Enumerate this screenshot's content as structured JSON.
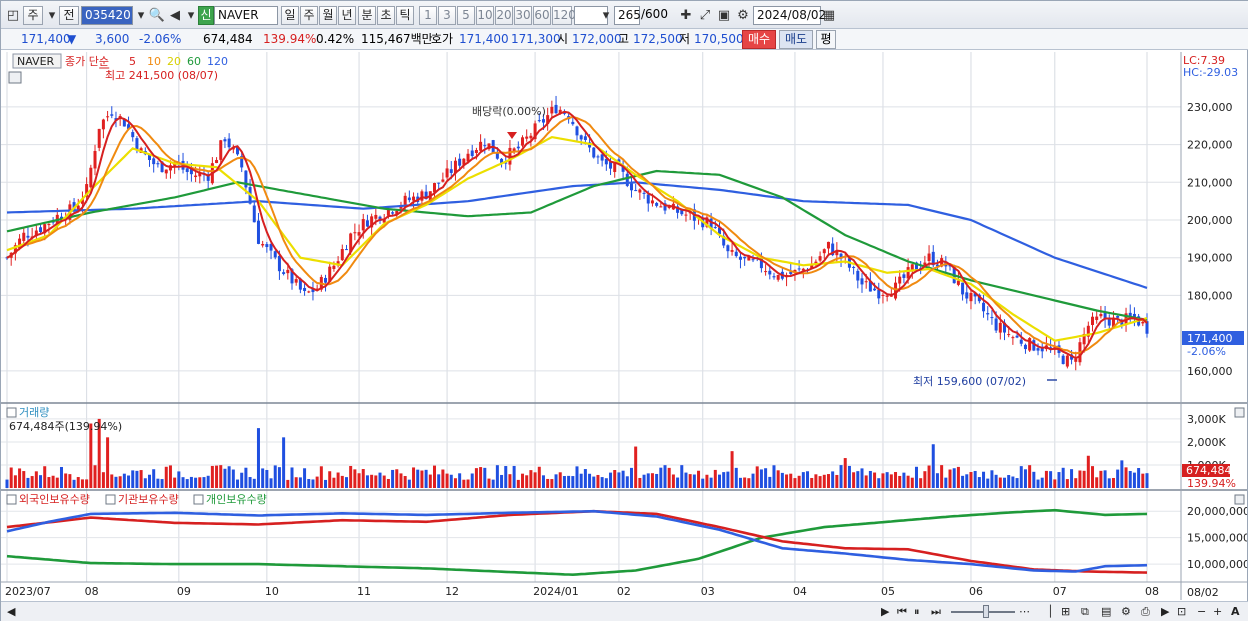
{
  "toolbar": {
    "period_labels": [
      "주",
      "전"
    ],
    "stock_code": "035420",
    "stock_name": "NAVER",
    "credit_badge": "신",
    "intervals": [
      "일",
      "주",
      "월",
      "년",
      "분",
      "초",
      "틱"
    ],
    "active_interval": "일",
    "numbers": [
      "1",
      "3",
      "5",
      "10",
      "20",
      "30",
      "60",
      "120"
    ],
    "count": "265",
    "count_total": "/600",
    "date": "2024/08/02"
  },
  "quote": {
    "price": "171,400",
    "change": "3,600",
    "change_pct": "-2.06%",
    "volume": "674,484",
    "volume_ratio": "139.94%",
    "turnover": "0.42%",
    "amount": "115,467백만",
    "ask_label": "호가",
    "ask1": "171,400",
    "ask2": "171,300",
    "open_label": "시",
    "open": "172,000",
    "high_label": "고",
    "high": "172,500",
    "low_label": "저",
    "low": "170,500",
    "buy_label": "매수",
    "sell_label": "매도",
    "eval_label": "평"
  },
  "chart_data": {
    "type": "line",
    "symbol": "NAVER",
    "legend": [
      {
        "name": "종가 단순",
        "color": "#d62020"
      },
      {
        "name": "5",
        "color": "#d62020"
      },
      {
        "name": "10",
        "color": "#f08a10"
      },
      {
        "name": "20",
        "color": "#e8e000"
      },
      {
        "name": "60",
        "color": "#1f9a3a"
      },
      {
        "name": "120",
        "color": "#2f5fe0"
      }
    ],
    "x_labels": [
      "2023/07",
      "08",
      "09",
      "10",
      "11",
      "12",
      "2024/01",
      "02",
      "03",
      "04",
      "05",
      "06",
      "07",
      "08"
    ],
    "current_date": "08/02",
    "price_axis": {
      "ylim": [
        152000,
        243500
      ],
      "ticks": [
        "230,000",
        "220,000",
        "210,000",
        "200,000",
        "190,000",
        "180,000",
        "160,000"
      ],
      "tick_values": [
        230000,
        220000,
        210000,
        200000,
        190000,
        180000,
        160000
      ]
    },
    "lc_label": "LC:7.39",
    "hc_label": "HC:-29.03",
    "last_price": "171,400",
    "last_change": "-2.06%",
    "high_annotation": "최고 241,500 (08/07)",
    "low_annotation": "최저 159,600 (07/02)",
    "dividend_annotation": "배당락(0.00%)",
    "price_anchors": [
      [
        0,
        190000
      ],
      [
        4,
        196000
      ],
      [
        8,
        198000
      ],
      [
        12,
        201000
      ],
      [
        16,
        203000
      ],
      [
        19,
        208000
      ],
      [
        22,
        225000
      ],
      [
        25,
        229000
      ],
      [
        28,
        226000
      ],
      [
        32,
        218000
      ],
      [
        36,
        214000
      ],
      [
        40,
        215000
      ],
      [
        44,
        212000
      ],
      [
        48,
        212000
      ],
      [
        52,
        222000
      ],
      [
        56,
        214000
      ],
      [
        60,
        195000
      ],
      [
        64,
        189000
      ],
      [
        68,
        184000
      ],
      [
        71,
        180000
      ],
      [
        74,
        182000
      ],
      [
        78,
        188000
      ],
      [
        82,
        196000
      ],
      [
        86,
        200000
      ],
      [
        90,
        202000
      ],
      [
        95,
        205000
      ],
      [
        100,
        207000
      ],
      [
        105,
        212000
      ],
      [
        110,
        218000
      ],
      [
        114,
        221000
      ],
      [
        118,
        216000
      ],
      [
        122,
        219000
      ],
      [
        126,
        224000
      ],
      [
        131,
        230000
      ],
      [
        134,
        228000
      ],
      [
        138,
        220000
      ],
      [
        142,
        215000
      ],
      [
        146,
        213000
      ],
      [
        150,
        208000
      ],
      [
        154,
        205000
      ],
      [
        158,
        203000
      ],
      [
        163,
        201000
      ],
      [
        168,
        199000
      ],
      [
        172,
        191000
      ],
      [
        176,
        189000
      ],
      [
        180,
        188000
      ],
      [
        184,
        185000
      ],
      [
        188,
        186000
      ],
      [
        192,
        188000
      ],
      [
        196,
        193000
      ],
      [
        200,
        189000
      ],
      [
        204,
        183000
      ],
      [
        208,
        181000
      ],
      [
        212,
        182000
      ],
      [
        216,
        187000
      ],
      [
        220,
        190000
      ],
      [
        224,
        188000
      ],
      [
        228,
        181000
      ],
      [
        232,
        177000
      ],
      [
        236,
        172000
      ],
      [
        240,
        169000
      ],
      [
        244,
        167000
      ],
      [
        248,
        166000
      ],
      [
        251,
        164000
      ],
      [
        254,
        162000
      ],
      [
        258,
        172000
      ],
      [
        261,
        174000
      ],
      [
        265,
        173000
      ],
      [
        269,
        174000
      ],
      [
        272,
        171400
      ]
    ],
    "ma_anchors": {
      "ma20": [
        [
          0,
          192000
        ],
        [
          10,
          196000
        ],
        [
          20,
          208000
        ],
        [
          30,
          219000
        ],
        [
          40,
          215000
        ],
        [
          50,
          214000
        ],
        [
          60,
          205000
        ],
        [
          70,
          190000
        ],
        [
          80,
          188000
        ],
        [
          90,
          199000
        ],
        [
          100,
          204000
        ],
        [
          110,
          211000
        ],
        [
          120,
          216000
        ],
        [
          130,
          222000
        ],
        [
          140,
          220000
        ],
        [
          150,
          212000
        ],
        [
          160,
          205000
        ],
        [
          170,
          196000
        ],
        [
          180,
          190000
        ],
        [
          190,
          188000
        ],
        [
          200,
          189000
        ],
        [
          210,
          186000
        ],
        [
          220,
          187000
        ],
        [
          230,
          183000
        ],
        [
          240,
          175000
        ],
        [
          250,
          168000
        ],
        [
          260,
          170000
        ],
        [
          272,
          174000
        ]
      ],
      "ma60": [
        [
          0,
          197000
        ],
        [
          20,
          202000
        ],
        [
          40,
          206000
        ],
        [
          55,
          210000
        ],
        [
          70,
          207000
        ],
        [
          90,
          203000
        ],
        [
          110,
          201000
        ],
        [
          125,
          202000
        ],
        [
          140,
          209000
        ],
        [
          155,
          213000
        ],
        [
          170,
          212000
        ],
        [
          185,
          206000
        ],
        [
          200,
          196000
        ],
        [
          215,
          189000
        ],
        [
          230,
          184000
        ],
        [
          245,
          180000
        ],
        [
          260,
          176000
        ],
        [
          272,
          173500
        ]
      ],
      "ma120": [
        [
          0,
          202000
        ],
        [
          30,
          203000
        ],
        [
          60,
          205000
        ],
        [
          85,
          203000
        ],
        [
          110,
          205000
        ],
        [
          135,
          209000
        ],
        [
          150,
          210000
        ],
        [
          170,
          208000
        ],
        [
          190,
          205000
        ],
        [
          215,
          204000
        ],
        [
          230,
          200000
        ],
        [
          250,
          190000
        ],
        [
          272,
          182000
        ]
      ]
    },
    "volume_panel": {
      "title": "거래량",
      "value_label": "674,484주(139.94%)",
      "ylim": [
        0,
        3300000
      ],
      "ticks": [
        "3,000K",
        "2,000K",
        "1,000K"
      ],
      "tick_values": [
        3000000,
        2000000,
        1000000
      ],
      "last_value": "674,484",
      "last_ratio": "139.94%",
      "spikes": [
        [
          20,
          2800000
        ],
        [
          22,
          3000000
        ],
        [
          24,
          2200000
        ],
        [
          60,
          2600000
        ],
        [
          66,
          2200000
        ],
        [
          150,
          1800000
        ],
        [
          173,
          1600000
        ],
        [
          200,
          1300000
        ],
        [
          221,
          1900000
        ],
        [
          258,
          1400000
        ],
        [
          266,
          1200000
        ]
      ]
    },
    "holdings_panel": {
      "series": [
        {
          "name": "외국인보유수량",
          "color": "#2f5fe0"
        },
        {
          "name": "기관보유수량",
          "color": "#d62020"
        },
        {
          "name": "개인보유수량",
          "color": "#1f9a3a"
        }
      ],
      "ylim": [
        7000000,
        22500000
      ],
      "ticks": [
        "20,000,000",
        "15,000,000",
        "10,000,000"
      ],
      "tick_values": [
        20000000,
        15000000,
        10000000
      ],
      "foreign": [
        [
          0,
          16200000
        ],
        [
          10,
          18000000
        ],
        [
          20,
          19500000
        ],
        [
          40,
          19700000
        ],
        [
          60,
          19200000
        ],
        [
          80,
          19600000
        ],
        [
          100,
          19300000
        ],
        [
          120,
          19700000
        ],
        [
          140,
          20000000
        ],
        [
          155,
          19000000
        ],
        [
          170,
          16500000
        ],
        [
          185,
          13000000
        ],
        [
          200,
          12000000
        ],
        [
          215,
          10800000
        ],
        [
          230,
          10000000
        ],
        [
          245,
          8800000
        ],
        [
          255,
          8600000
        ],
        [
          262,
          9600000
        ],
        [
          272,
          9800000
        ]
      ],
      "institution": [
        [
          0,
          17000000
        ],
        [
          20,
          18800000
        ],
        [
          40,
          17800000
        ],
        [
          60,
          17500000
        ],
        [
          80,
          18300000
        ],
        [
          100,
          18000000
        ],
        [
          120,
          19300000
        ],
        [
          140,
          20000000
        ],
        [
          155,
          19500000
        ],
        [
          170,
          17000000
        ],
        [
          185,
          14300000
        ],
        [
          200,
          13000000
        ],
        [
          215,
          12800000
        ],
        [
          230,
          10600000
        ],
        [
          245,
          9000000
        ],
        [
          258,
          8600000
        ],
        [
          272,
          8400000
        ]
      ],
      "individual": [
        [
          0,
          11500000
        ],
        [
          20,
          10200000
        ],
        [
          40,
          10000000
        ],
        [
          60,
          10000000
        ],
        [
          80,
          9600000
        ],
        [
          100,
          9200000
        ],
        [
          120,
          8500000
        ],
        [
          135,
          8000000
        ],
        [
          150,
          8800000
        ],
        [
          165,
          11000000
        ],
        [
          180,
          15000000
        ],
        [
          195,
          17000000
        ],
        [
          210,
          18000000
        ],
        [
          225,
          19000000
        ],
        [
          240,
          19800000
        ],
        [
          250,
          20200000
        ],
        [
          262,
          19300000
        ],
        [
          272,
          19500000
        ]
      ]
    }
  }
}
